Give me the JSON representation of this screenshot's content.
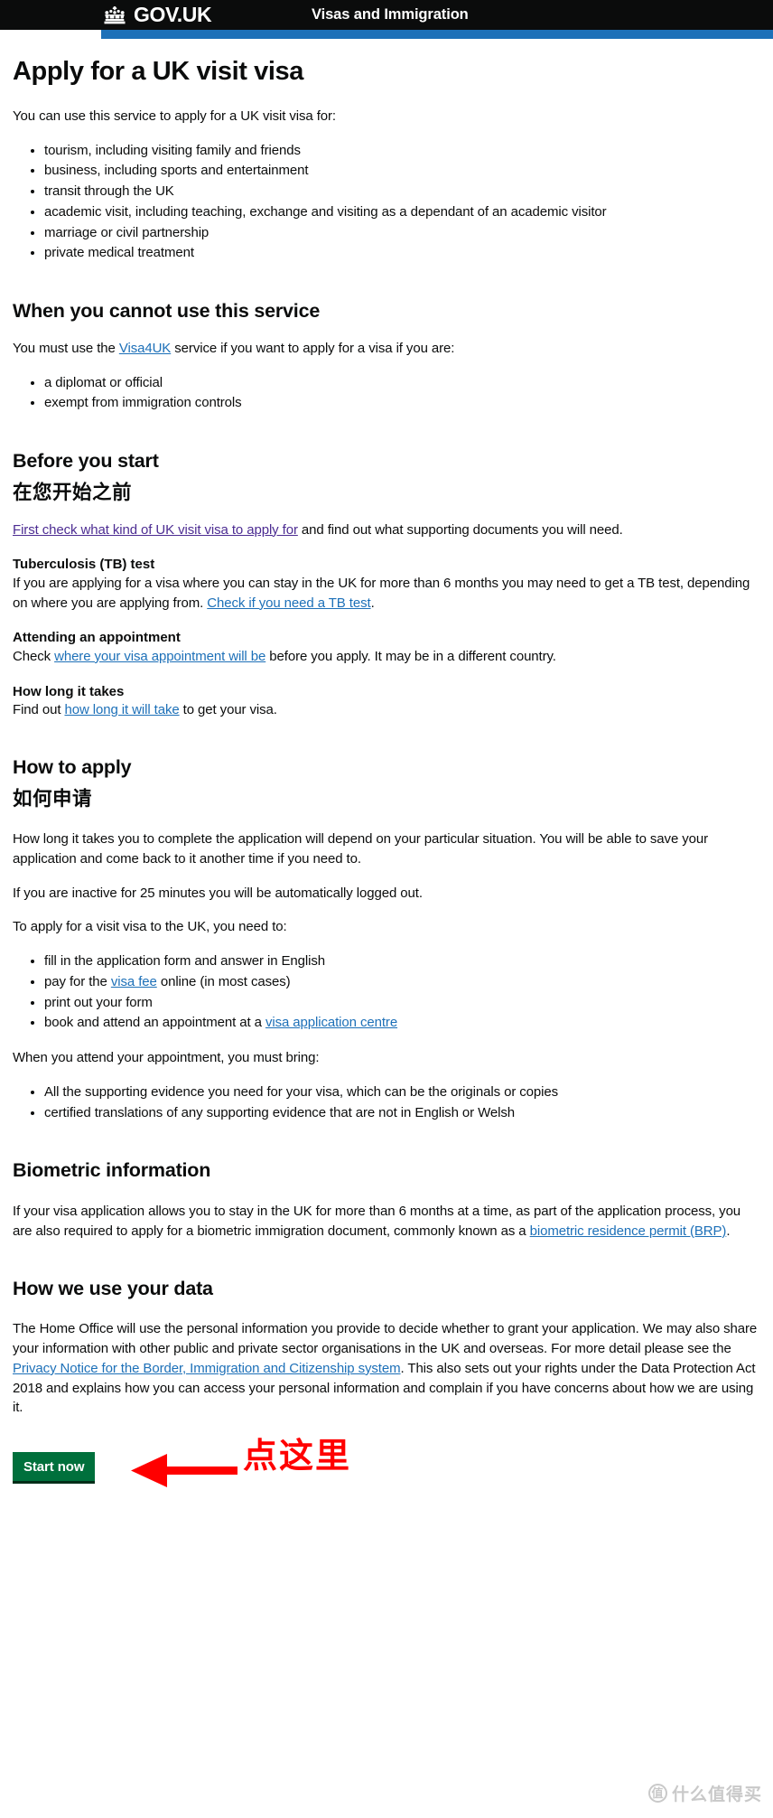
{
  "header": {
    "brand": "GOV.UK",
    "crown_icon": "crown-icon",
    "service_name": "Visas and Immigration"
  },
  "page": {
    "title": "Apply for a UK visit visa",
    "intro": "You can use this service to apply for a UK visit visa for:",
    "intro_bullets": [
      "tourism, including visiting family and friends",
      "business, including sports and entertainment",
      "transit through the UK",
      "academic visit, including teaching, exchange and visiting as a dependant of an academic visitor",
      "marriage or civil partnership",
      "private medical treatment"
    ],
    "cannot_use": {
      "heading": "When you cannot use this service",
      "para_before_link": "You must use the ",
      "link_text": "Visa4UK",
      "para_after_link": " service if you want to apply for a visa if you are:",
      "bullets": [
        "a diplomat or official",
        "exempt from immigration controls"
      ]
    },
    "before_you_start": {
      "heading": "Before you start",
      "heading_cn": "在您开始之前",
      "intro_link": "First check what kind of UK visit visa to apply for",
      "intro_after": " and find out what supporting documents you will need.",
      "tb": {
        "heading": "Tuberculosis (TB) test",
        "text_before_link": "If you are applying for a visa where you can stay in the UK for more than 6 months you may need to get a TB test, depending on where you are applying from. ",
        "link_text": "Check if you need a TB test",
        "text_after_link": "."
      },
      "appointment": {
        "heading": "Attending an appointment",
        "text_before_link": "Check ",
        "link_text": "where your visa appointment will be",
        "text_after_link": " before you apply. It may be in a different country."
      },
      "how_long": {
        "heading": "How long it takes",
        "text_before_link": "Find out ",
        "link_text": "how long it will take",
        "text_after_link": " to get your visa."
      }
    },
    "how_to_apply": {
      "heading": "How to apply",
      "heading_cn": "如何申请",
      "para1": "How long it takes you to complete the application will depend on your particular situation. You will be able to save your application and come back to it another time if you need to.",
      "para2": "If you are inactive for 25 minutes you will be automatically logged out.",
      "para3": "To apply for a visit visa to the UK, you need to:",
      "need_to_bullets": {
        "b1": "fill in the application form and answer in English",
        "b2_before": "pay for the ",
        "b2_link": "visa fee",
        "b2_after": " online (in most cases)",
        "b3": "print out your form",
        "b4_before": "book and attend an appointment at a ",
        "b4_link": "visa application centre",
        "b4_after": ""
      },
      "bring_intro": "When you attend your appointment, you must bring:",
      "bring_bullets": [
        "All the supporting evidence you need for your visa, which can be the originals or copies",
        "certified translations of any supporting evidence that are not in English or Welsh"
      ]
    },
    "biometric": {
      "heading": "Biometric information",
      "text_before_link": "If your visa application allows you to stay in the UK for more than 6 months at a time, as part of the application process, you are also required to apply for a biometric immigration document, commonly known as a ",
      "link_text": "biometric residence permit (BRP)",
      "text_after_link": "."
    },
    "how_we_use_data": {
      "heading": "How we use your data",
      "text_before_link": "The Home Office will use the personal information you provide to decide whether to grant your application. We may also share your information with other public and private sector organisations in the UK and overseas. For more detail please see the ",
      "link_text": "Privacy Notice for the Border, Immigration and Citizenship system",
      "text_after_link": ". This also sets out your rights under the Data Protection Act 2018 and explains how you can access your personal information and complain if you have concerns about how we are using it."
    },
    "start_button_label": "Start now",
    "annotation": {
      "arrow_icon": "left-arrow-icon",
      "text": "点这里",
      "color": "#ff0000"
    }
  },
  "watermark": {
    "mark": "值",
    "text": "什么值得买"
  },
  "colors": {
    "header_bg": "#0b0c0c",
    "accent_blue": "#1d70b8",
    "link_blue": "#1d70b8",
    "link_visited": "#4c2c92",
    "button_green": "#00703c",
    "annotation_red": "#ff0000"
  }
}
